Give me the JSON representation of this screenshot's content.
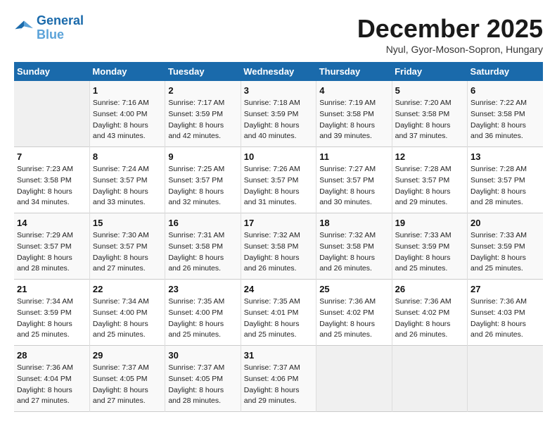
{
  "logo": {
    "line1": "General",
    "line2": "Blue"
  },
  "title": "December 2025",
  "location": "Nyul, Gyor-Moson-Sopron, Hungary",
  "headers": [
    "Sunday",
    "Monday",
    "Tuesday",
    "Wednesday",
    "Thursday",
    "Friday",
    "Saturday"
  ],
  "weeks": [
    [
      {
        "day": "",
        "sunrise": "",
        "sunset": "",
        "daylight": ""
      },
      {
        "day": "1",
        "sunrise": "Sunrise: 7:16 AM",
        "sunset": "Sunset: 4:00 PM",
        "daylight": "Daylight: 8 hours and 43 minutes."
      },
      {
        "day": "2",
        "sunrise": "Sunrise: 7:17 AM",
        "sunset": "Sunset: 3:59 PM",
        "daylight": "Daylight: 8 hours and 42 minutes."
      },
      {
        "day": "3",
        "sunrise": "Sunrise: 7:18 AM",
        "sunset": "Sunset: 3:59 PM",
        "daylight": "Daylight: 8 hours and 40 minutes."
      },
      {
        "day": "4",
        "sunrise": "Sunrise: 7:19 AM",
        "sunset": "Sunset: 3:58 PM",
        "daylight": "Daylight: 8 hours and 39 minutes."
      },
      {
        "day": "5",
        "sunrise": "Sunrise: 7:20 AM",
        "sunset": "Sunset: 3:58 PM",
        "daylight": "Daylight: 8 hours and 37 minutes."
      },
      {
        "day": "6",
        "sunrise": "Sunrise: 7:22 AM",
        "sunset": "Sunset: 3:58 PM",
        "daylight": "Daylight: 8 hours and 36 minutes."
      }
    ],
    [
      {
        "day": "7",
        "sunrise": "Sunrise: 7:23 AM",
        "sunset": "Sunset: 3:58 PM",
        "daylight": "Daylight: 8 hours and 34 minutes."
      },
      {
        "day": "8",
        "sunrise": "Sunrise: 7:24 AM",
        "sunset": "Sunset: 3:57 PM",
        "daylight": "Daylight: 8 hours and 33 minutes."
      },
      {
        "day": "9",
        "sunrise": "Sunrise: 7:25 AM",
        "sunset": "Sunset: 3:57 PM",
        "daylight": "Daylight: 8 hours and 32 minutes."
      },
      {
        "day": "10",
        "sunrise": "Sunrise: 7:26 AM",
        "sunset": "Sunset: 3:57 PM",
        "daylight": "Daylight: 8 hours and 31 minutes."
      },
      {
        "day": "11",
        "sunrise": "Sunrise: 7:27 AM",
        "sunset": "Sunset: 3:57 PM",
        "daylight": "Daylight: 8 hours and 30 minutes."
      },
      {
        "day": "12",
        "sunrise": "Sunrise: 7:28 AM",
        "sunset": "Sunset: 3:57 PM",
        "daylight": "Daylight: 8 hours and 29 minutes."
      },
      {
        "day": "13",
        "sunrise": "Sunrise: 7:28 AM",
        "sunset": "Sunset: 3:57 PM",
        "daylight": "Daylight: 8 hours and 28 minutes."
      }
    ],
    [
      {
        "day": "14",
        "sunrise": "Sunrise: 7:29 AM",
        "sunset": "Sunset: 3:57 PM",
        "daylight": "Daylight: 8 hours and 28 minutes."
      },
      {
        "day": "15",
        "sunrise": "Sunrise: 7:30 AM",
        "sunset": "Sunset: 3:57 PM",
        "daylight": "Daylight: 8 hours and 27 minutes."
      },
      {
        "day": "16",
        "sunrise": "Sunrise: 7:31 AM",
        "sunset": "Sunset: 3:58 PM",
        "daylight": "Daylight: 8 hours and 26 minutes."
      },
      {
        "day": "17",
        "sunrise": "Sunrise: 7:32 AM",
        "sunset": "Sunset: 3:58 PM",
        "daylight": "Daylight: 8 hours and 26 minutes."
      },
      {
        "day": "18",
        "sunrise": "Sunrise: 7:32 AM",
        "sunset": "Sunset: 3:58 PM",
        "daylight": "Daylight: 8 hours and 26 minutes."
      },
      {
        "day": "19",
        "sunrise": "Sunrise: 7:33 AM",
        "sunset": "Sunset: 3:59 PM",
        "daylight": "Daylight: 8 hours and 25 minutes."
      },
      {
        "day": "20",
        "sunrise": "Sunrise: 7:33 AM",
        "sunset": "Sunset: 3:59 PM",
        "daylight": "Daylight: 8 hours and 25 minutes."
      }
    ],
    [
      {
        "day": "21",
        "sunrise": "Sunrise: 7:34 AM",
        "sunset": "Sunset: 3:59 PM",
        "daylight": "Daylight: 8 hours and 25 minutes."
      },
      {
        "day": "22",
        "sunrise": "Sunrise: 7:34 AM",
        "sunset": "Sunset: 4:00 PM",
        "daylight": "Daylight: 8 hours and 25 minutes."
      },
      {
        "day": "23",
        "sunrise": "Sunrise: 7:35 AM",
        "sunset": "Sunset: 4:00 PM",
        "daylight": "Daylight: 8 hours and 25 minutes."
      },
      {
        "day": "24",
        "sunrise": "Sunrise: 7:35 AM",
        "sunset": "Sunset: 4:01 PM",
        "daylight": "Daylight: 8 hours and 25 minutes."
      },
      {
        "day": "25",
        "sunrise": "Sunrise: 7:36 AM",
        "sunset": "Sunset: 4:02 PM",
        "daylight": "Daylight: 8 hours and 25 minutes."
      },
      {
        "day": "26",
        "sunrise": "Sunrise: 7:36 AM",
        "sunset": "Sunset: 4:02 PM",
        "daylight": "Daylight: 8 hours and 26 minutes."
      },
      {
        "day": "27",
        "sunrise": "Sunrise: 7:36 AM",
        "sunset": "Sunset: 4:03 PM",
        "daylight": "Daylight: 8 hours and 26 minutes."
      }
    ],
    [
      {
        "day": "28",
        "sunrise": "Sunrise: 7:36 AM",
        "sunset": "Sunset: 4:04 PM",
        "daylight": "Daylight: 8 hours and 27 minutes."
      },
      {
        "day": "29",
        "sunrise": "Sunrise: 7:37 AM",
        "sunset": "Sunset: 4:05 PM",
        "daylight": "Daylight: 8 hours and 27 minutes."
      },
      {
        "day": "30",
        "sunrise": "Sunrise: 7:37 AM",
        "sunset": "Sunset: 4:05 PM",
        "daylight": "Daylight: 8 hours and 28 minutes."
      },
      {
        "day": "31",
        "sunrise": "Sunrise: 7:37 AM",
        "sunset": "Sunset: 4:06 PM",
        "daylight": "Daylight: 8 hours and 29 minutes."
      },
      {
        "day": "",
        "sunrise": "",
        "sunset": "",
        "daylight": ""
      },
      {
        "day": "",
        "sunrise": "",
        "sunset": "",
        "daylight": ""
      },
      {
        "day": "",
        "sunrise": "",
        "sunset": "",
        "daylight": ""
      }
    ]
  ]
}
